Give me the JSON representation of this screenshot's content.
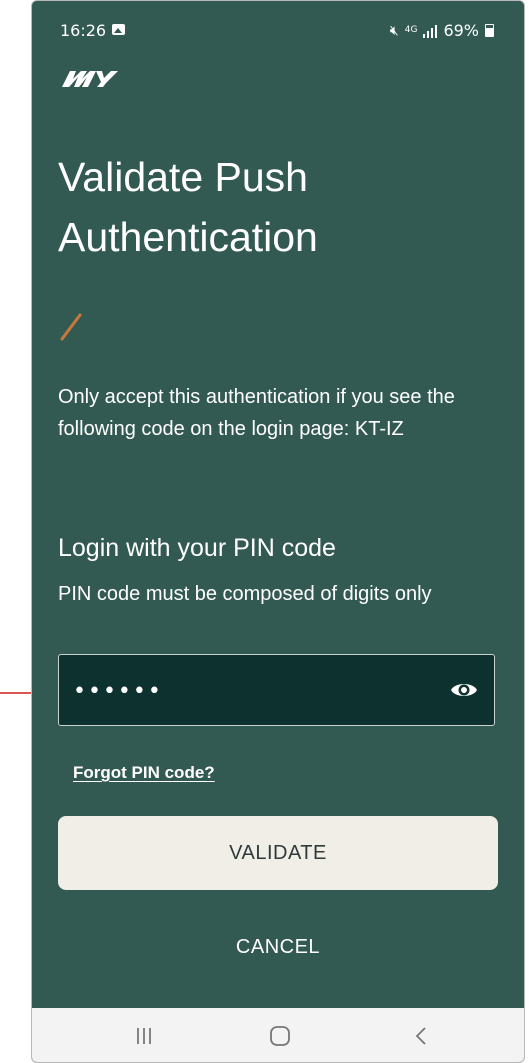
{
  "status_bar": {
    "time": "16:26",
    "network": "4G",
    "battery": "69%",
    "icons": [
      "gallery-icon",
      "mute-icon",
      "signal-icon",
      "battery-icon"
    ]
  },
  "brand": {
    "logo_text": "MY",
    "colors": {
      "background": "#335a52",
      "field_background": "#0c312f",
      "accent": "#c9783a",
      "button_background": "#f1ede7",
      "annotation": "#d11d1d"
    }
  },
  "auth": {
    "title": "Validate Push Authentication",
    "info": "Only accept this authentication if you see the following code on the login page: KT-IZ",
    "pin_heading": "Login with your PIN code",
    "pin_hint": "PIN code must be composed of digits only",
    "pin_value": "••••••",
    "forgot_link": "Forgot PIN code?",
    "validate_label": "VALIDATE",
    "cancel_label": "CANCEL"
  },
  "nav": {
    "items": [
      "recent-apps-icon",
      "home-icon",
      "back-icon"
    ]
  }
}
